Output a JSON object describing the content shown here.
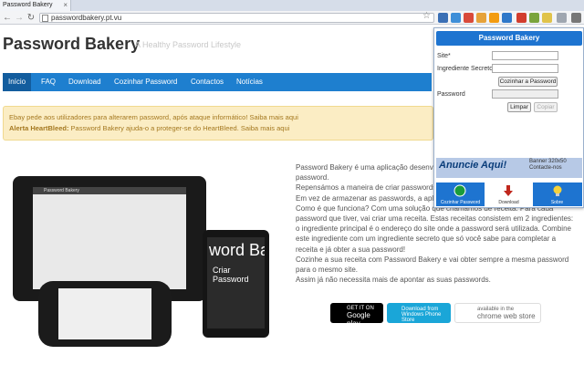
{
  "browser": {
    "tab_title": "Password Bakery",
    "tab_close": "×",
    "url": "passwordbakery.pt.vu",
    "back_icon": "arrow-left-icon",
    "forward_icon": "arrow-right-icon",
    "reload_icon": "reload-icon",
    "home_icon": "home-icon",
    "star_icon": "star-icon",
    "back_glyph": "←",
    "forward_glyph": "→",
    "reload_glyph": "↻",
    "home_glyph": "⌂",
    "star_glyph": "☆"
  },
  "site": {
    "title": "Password Bakery",
    "tagline": "A Healthy Password Lifestyle"
  },
  "nav": {
    "items": [
      {
        "label": "Início"
      },
      {
        "label": "FAQ"
      },
      {
        "label": "Download"
      },
      {
        "label": "Cozinhar Password"
      },
      {
        "label": "Contactos"
      },
      {
        "label": "Notícias"
      }
    ]
  },
  "alert": {
    "line1": "Ebay pede aos utilizadores para alterarem password, após ataque informático!",
    "line1_link": "Saiba mais aqui",
    "line2_prefix": "Alerta HeartBleed:",
    "line2": "Password Bakery ajuda-o a proteger-se do HeartBleed.",
    "line2_link": "Saiba mais aqui"
  },
  "devices": {
    "tablet_app_title": "Password Bakery",
    "phone2_big": "word Bake",
    "phone2_sub": "Criar Password"
  },
  "description": {
    "p1": "Password Bakery é uma aplicação desenvolvida para aumentar a segurança da sua password.",
    "p2": "Repensámos a maneira de criar passwords.",
    "p3": "Em vez de armazenar as passwords, a aplicação cria-as delas.",
    "p4": "Como é que funciona? Com uma solução que chamamos de receita. Para cada password que tiver, vai criar uma receita. Estas receitas consistem em 2 ingredientes: o ingrediente principal é o endereço do site onde a password será utilizada. Combine este ingrediente com um ingrediente secreto que só você sabe para completar a receita e já obter a sua password!",
    "p5": "Cozinhe a sua receita com Password Bakery e vai obter sempre a mesma password para o mesmo site.",
    "p6": "Assim já não necessita mais de apontar as suas passwords."
  },
  "badges": {
    "gplay_small": "GET IT ON",
    "gplay_big": "Google play",
    "phone_store_line1": "Download from",
    "phone_store_line2": "Windows Phone Store",
    "chrome_small": "available in the",
    "chrome_big": "chrome web store"
  },
  "popup": {
    "title": "Password Bakery",
    "site_label": "Site*",
    "secret_label": "Ingrediente Secreto*",
    "cook_button": "Cozinhar a Password",
    "password_label": "Password",
    "clear_button": "Limpar",
    "copy_button": "Copiar",
    "ad_main": "Anuncie Aqui!",
    "ad_side_1": "Banner 320x50",
    "ad_side_2": "Contacte-nos",
    "footer": [
      {
        "label": "Cozinhar Password",
        "icon": "cookie-icon"
      },
      {
        "label": "Download",
        "icon": "download-arrow-icon"
      },
      {
        "label": "Sobre",
        "icon": "lightbulb-icon"
      }
    ]
  },
  "colors": {
    "nav_blue": "#1e7fcf",
    "alert_bg": "#fbedc4",
    "popup_blue": "#1e74d0"
  }
}
